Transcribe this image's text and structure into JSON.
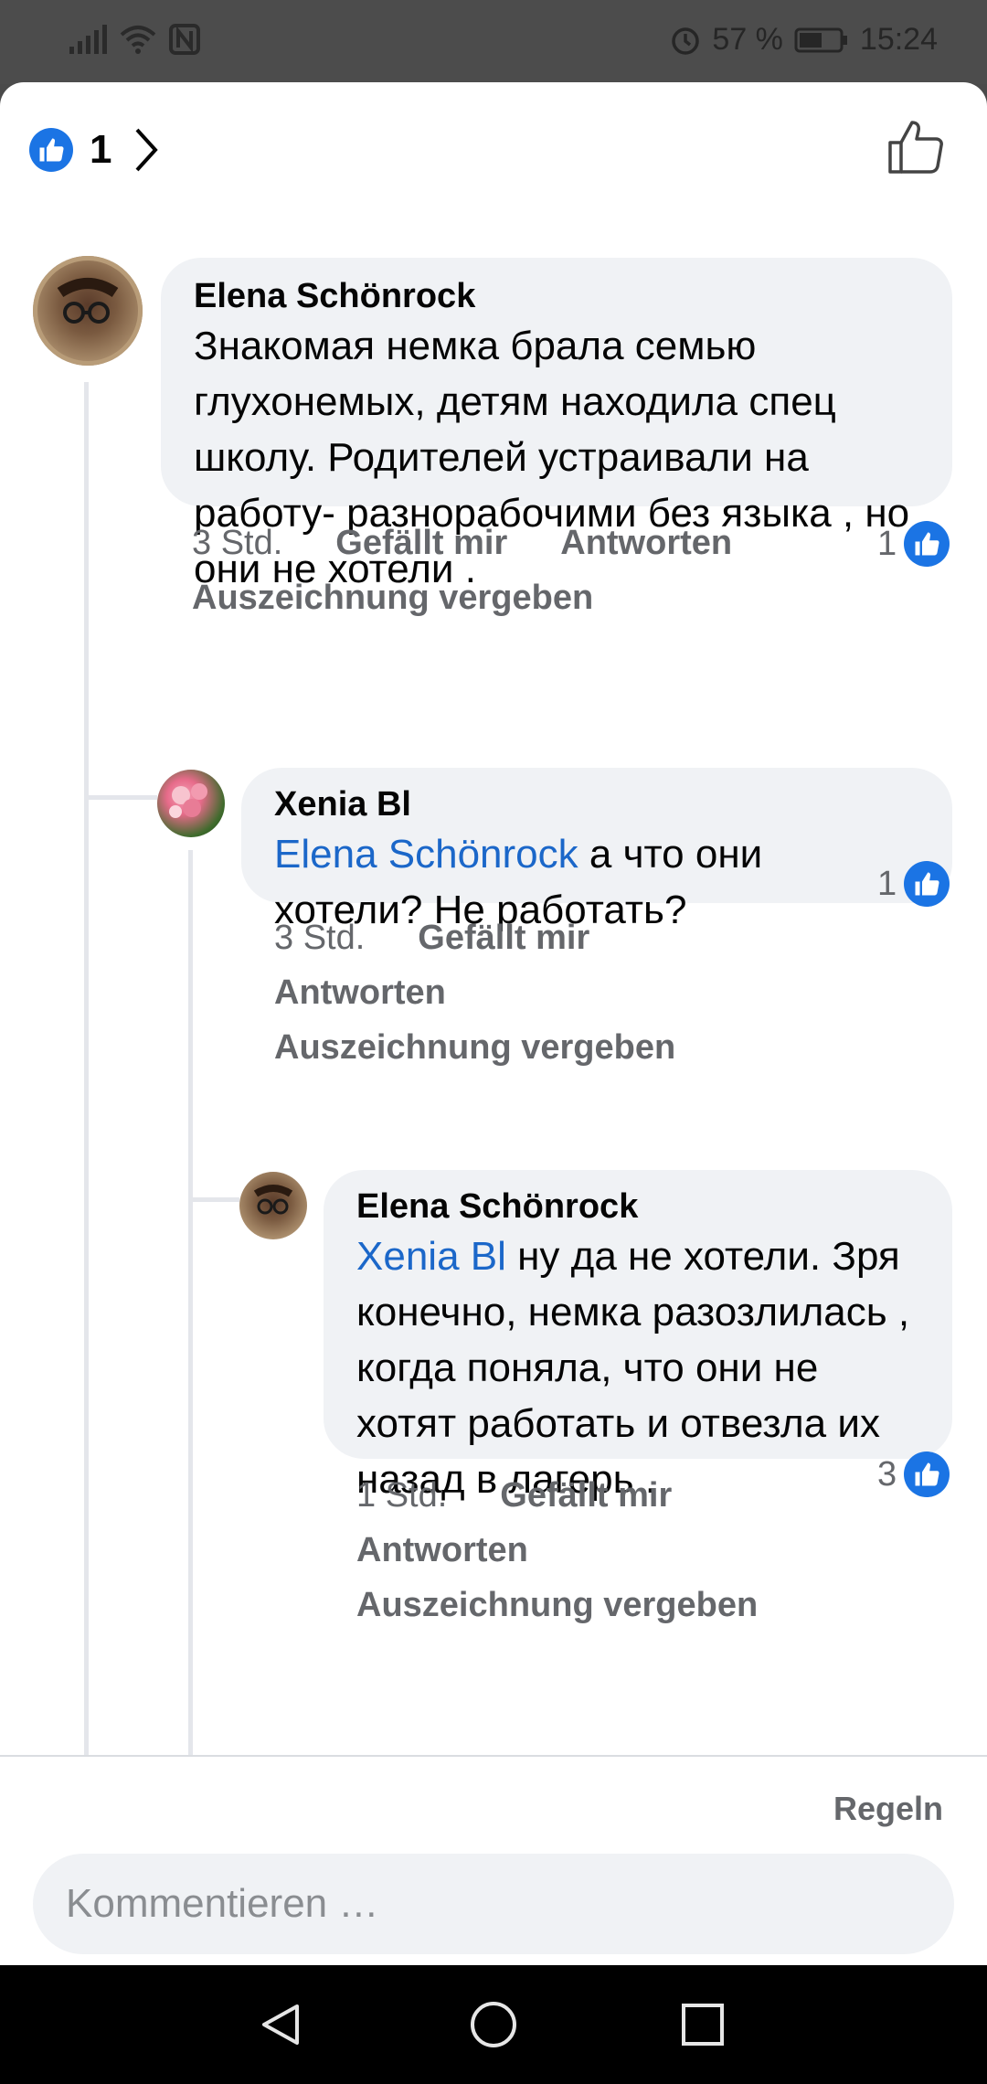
{
  "status_bar": {
    "alarm_icon": "alarm-icon",
    "battery_percent": "57 %",
    "time": "15:24"
  },
  "header": {
    "reaction_count": "1"
  },
  "comments": [
    {
      "author": "Elena Schönrock",
      "text": "Знакомая немка брала семью глухонемых,  детям находила спец школу.  Родителей устраивали на работу- разнорабочими без языка  , но они не хотели .",
      "time": "3 Std.",
      "like_label": "Gefällt mir",
      "reply_label": "Antworten",
      "award_label": "Auszeichnung vergeben",
      "reactions": "1"
    },
    {
      "author": "Xenia Bl",
      "mention": "Elena Schönrock",
      "text": " а что они хотели? Не работать?",
      "time": "3 Std.",
      "like_label": "Gefällt mir",
      "reply_label": "Antworten",
      "award_label": "Auszeichnung vergeben",
      "reactions": "1"
    },
    {
      "author": "Elena Schönrock",
      "mention": "Xenia Bl",
      "text": " ну да не хотели. Зря конечно, немка разозлилась , когда поняла, что они не хотят работать и отвезла их назад в лагерь .",
      "time": "1 Std.",
      "like_label": "Gefällt mir",
      "reply_label": "Antworten",
      "award_label": "Auszeichnung vergeben",
      "reactions": "3"
    }
  ],
  "composer": {
    "rules_label": "Regeln",
    "placeholder": "Kommentieren …"
  },
  "colors": {
    "accent": "#1b74e4",
    "bubble": "#f0f2f5",
    "meta": "#65676b",
    "mention": "#1b67c9"
  }
}
